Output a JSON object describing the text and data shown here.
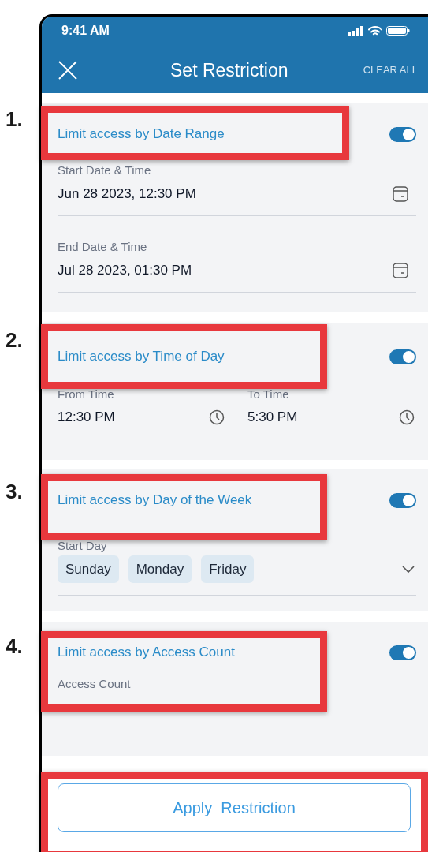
{
  "status_bar": {
    "time": "9:41 AM"
  },
  "header": {
    "title": "Set Restriction",
    "action": "CLEAR ALL"
  },
  "sections": [
    {
      "kind": "date_range",
      "title": "Limit access by Date Range",
      "on": true,
      "fields": [
        {
          "label": "Start Date & Time",
          "value": "Jun 28 2023, 12:30 PM"
        },
        {
          "label": "End Date & Time",
          "value": "Jul 28 2023, 01:30 PM"
        }
      ]
    },
    {
      "kind": "time_of_day",
      "title": "Limit access by Time of Day",
      "on": true,
      "fields": [
        {
          "label": "From Time",
          "value": "12:30 PM"
        },
        {
          "label": "To Time",
          "value": "5:30 PM"
        }
      ]
    },
    {
      "kind": "day_of_week",
      "title": "Limit access by Day of the Week",
      "on": true,
      "label": "Start Day",
      "chips": [
        "Sunday",
        "Monday",
        "Friday"
      ]
    },
    {
      "kind": "access_count",
      "title": "Limit access by Access Count",
      "on": true,
      "placeholder": "Access Count"
    }
  ],
  "apply_button": "Apply  Restriction",
  "annotations": [
    {
      "kind": "numbered",
      "label": "1."
    },
    {
      "kind": "numbered",
      "label": "2."
    },
    {
      "kind": "numbered",
      "label": "3."
    },
    {
      "kind": "numbered",
      "label": "4."
    },
    {
      "kind": "box"
    }
  ]
}
